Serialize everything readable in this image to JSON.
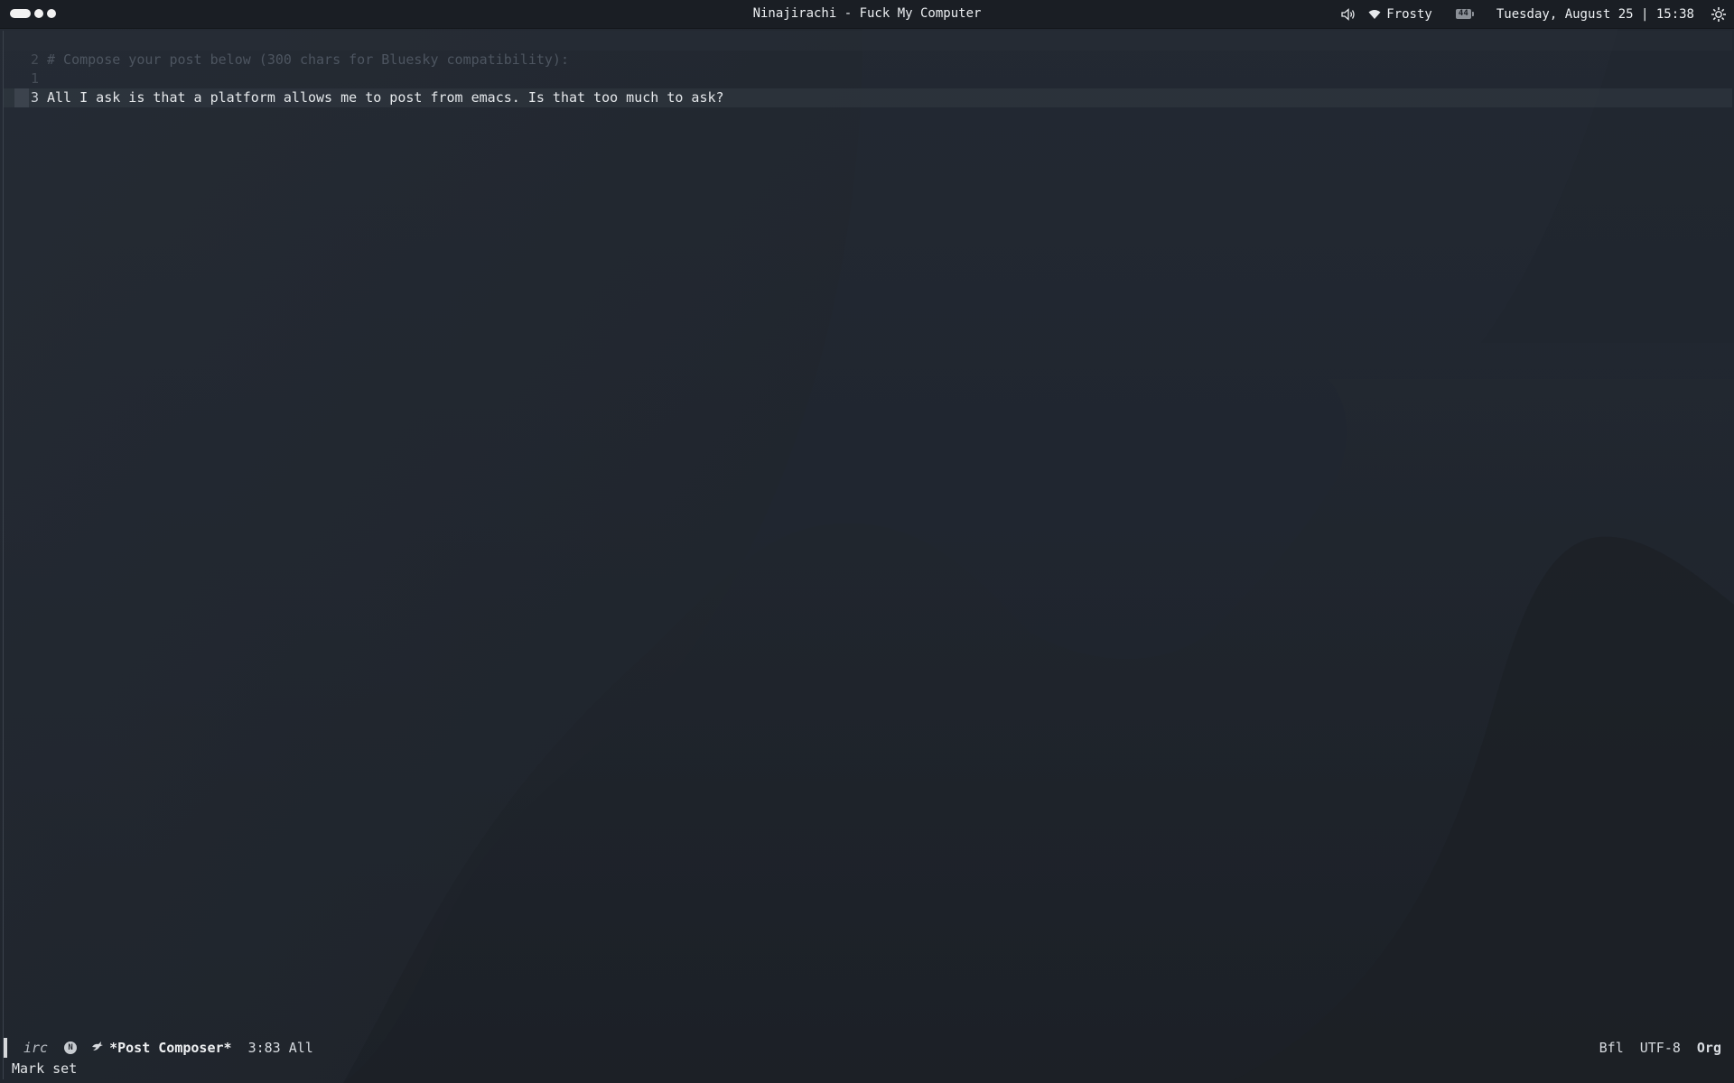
{
  "topbar": {
    "window_title": "Ninajirachi - Fuck My Computer",
    "wifi_name": "Frosty",
    "battery_level": "44",
    "datetime": "Tuesday, August 25 | 15:38",
    "icons": [
      "speaker-icon",
      "wifi-icon",
      "battery-icon",
      "gear-icon"
    ]
  },
  "buffer": {
    "lines": [
      {
        "number": "2",
        "text": "# Compose your post below (300 chars for Bluesky compatibility):"
      },
      {
        "number": "1",
        "text": ""
      },
      {
        "number": "3",
        "text": "All I ask is that a platform allows me to post from emacs. Is that too much to ask?"
      }
    ]
  },
  "modeline": {
    "mode": "irc",
    "badge": "N",
    "buffer_name": "*Post Composer*",
    "position": "3:83 All",
    "right": [
      "Bfl",
      "UTF-8",
      "Org"
    ]
  },
  "echo_area": "Mark set",
  "colors": {
    "background": "#1f242b",
    "topbar": "#1a1e24",
    "text": "#e4e7ea",
    "comment": "#4d5560"
  }
}
